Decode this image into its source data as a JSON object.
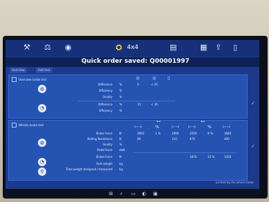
{
  "toolbar": {
    "badge_text": "4x4",
    "icons": [
      "tool-icon",
      "scale-icon",
      "dial-icon",
      "vehicle-icon",
      "printer-icon",
      "report-icon",
      "export-icon",
      "device-icon"
    ]
  },
  "title": "Quick order saved: Q00001997",
  "tabs": [
    "Overview",
    "Axle test"
  ],
  "panel1": {
    "label": "Overview brake test",
    "col_header_values": [
      "0",
      "< 25"
    ],
    "rows": [
      {
        "label": "Difference",
        "unit": "%",
        "v1": "0",
        "v2": "< 25"
      },
      {
        "label": "Efficiency",
        "unit": "%",
        "v1": "",
        "v2": ""
      },
      {
        "label": "Ovality",
        "unit": "%",
        "v1": "",
        "v2": ""
      },
      {
        "label": "Difference",
        "unit": "%",
        "v1": "15",
        "v2": "< 30"
      },
      {
        "label": "Efficiency",
        "unit": "%",
        "v1": "",
        "v2": ""
      }
    ]
  },
  "panel2": {
    "label": "Wheels brake test",
    "rows": [
      {
        "label": "Brake Force",
        "unit": "N",
        "vals": [
          "2893",
          "1 %",
          "2890",
          "2029",
          "9 %",
          "1840"
        ]
      },
      {
        "label": "Rolling Resistance",
        "unit": "N",
        "vals": [
          "80",
          "",
          "110",
          "470",
          "",
          "490"
        ]
      },
      {
        "label": "Ovality",
        "unit": "%",
        "vals": [
          "",
          "",
          "",
          "",
          "",
          ""
        ]
      },
      {
        "label": "Pedal force",
        "unit": "daN",
        "vals": [
          "",
          "",
          "",
          "",
          "",
          ""
        ]
      },
      {
        "label": "Brake Force",
        "unit": "N",
        "vals": [
          "",
          "",
          "",
          "1870",
          "25 %",
          "1420"
        ]
      },
      {
        "label": "Axle weight",
        "unit": "kg",
        "vals": [
          "",
          "",
          "",
          "",
          "",
          ""
        ]
      },
      {
        "label": "Total weight designed / measured",
        "unit": "kg",
        "vals": [
          "",
          "",
          "",
          "",
          "",
          ""
        ]
      }
    ]
  },
  "footer": "Limited by the wheel motor"
}
